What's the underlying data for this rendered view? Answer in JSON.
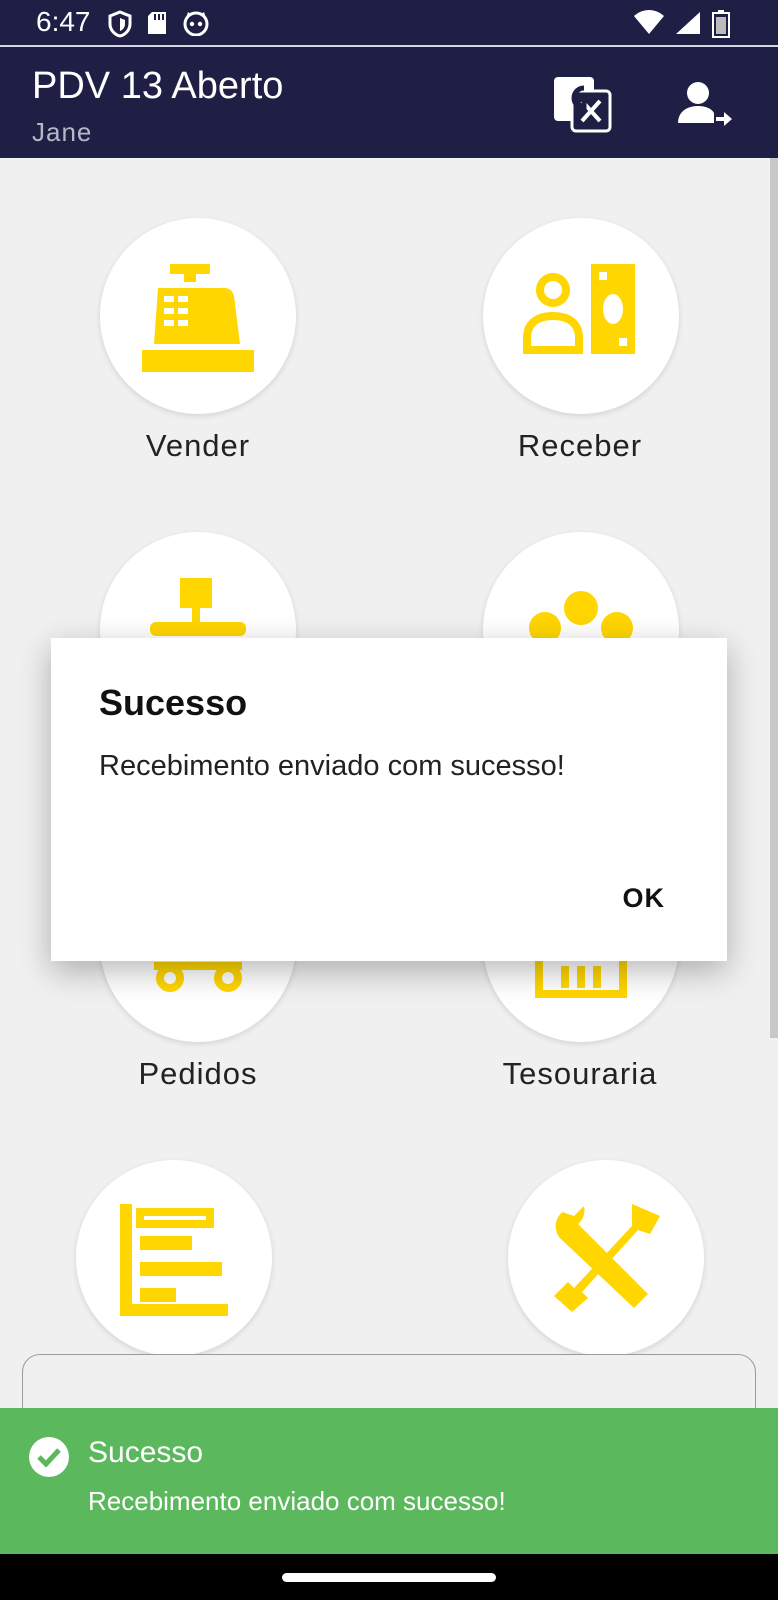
{
  "status_bar": {
    "time": "6:47",
    "icons_left": [
      "shield-icon",
      "sd-card-icon",
      "cat-face-icon"
    ],
    "icons_right": [
      "wifi-icon",
      "signal-icon",
      "battery-icon"
    ]
  },
  "app_bar": {
    "title": "PDV 13 Aberto",
    "subtitle": "Jane",
    "actions": [
      "translate-icon",
      "logout-user-icon"
    ],
    "background": "#1f1f46"
  },
  "menu": {
    "accent_color": "#ffd600",
    "items": [
      {
        "label": "Vender",
        "icon": "cash-register-icon"
      },
      {
        "label": "Receber",
        "icon": "receive-payment-icon"
      },
      {
        "label": "",
        "icon": "hierarchy-icon"
      },
      {
        "label": "",
        "icon": "clients-group-icon"
      },
      {
        "label": "Pedidos",
        "icon": "delivery-cart-icon"
      },
      {
        "label": "Tesouraria",
        "icon": "treasury-icon"
      },
      {
        "label": "",
        "icon": "report-chart-icon"
      },
      {
        "label": "",
        "icon": "tools-icon"
      }
    ]
  },
  "dialog": {
    "title": "Sucesso",
    "message": "Recebimento enviado com sucesso!",
    "ok_label": "OK"
  },
  "toast": {
    "title": "Sucesso",
    "message": "Recebimento enviado com sucesso!",
    "icon": "check-circle-icon",
    "color": "#5cb85c"
  }
}
